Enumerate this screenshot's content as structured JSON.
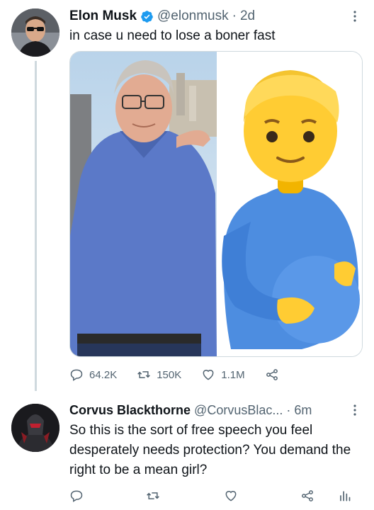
{
  "tweet": {
    "author_name": "Elon Musk",
    "handle": "@elonmusk",
    "separator": "·",
    "time": "2d",
    "text": "in case u need to lose a boner fast",
    "stats": {
      "replies": "64.2K",
      "retweets": "150K",
      "likes": "1.1M"
    }
  },
  "reply": {
    "author_name": "Corvus Blackthorne",
    "handle": "@CorvusBlac...",
    "separator": "·",
    "time": "6m",
    "text": "So this is the sort of free speech you feel desperately needs protection? You demand the right to be a mean girl?"
  },
  "colors": {
    "text": "#0f1419",
    "secondary": "#536471",
    "verified": "#1d9bf0",
    "thread_line": "#cfd9de"
  },
  "icons": [
    "verified-icon",
    "more-icon",
    "reply-icon",
    "retweet-icon",
    "like-icon",
    "share-icon",
    "analytics-icon"
  ]
}
